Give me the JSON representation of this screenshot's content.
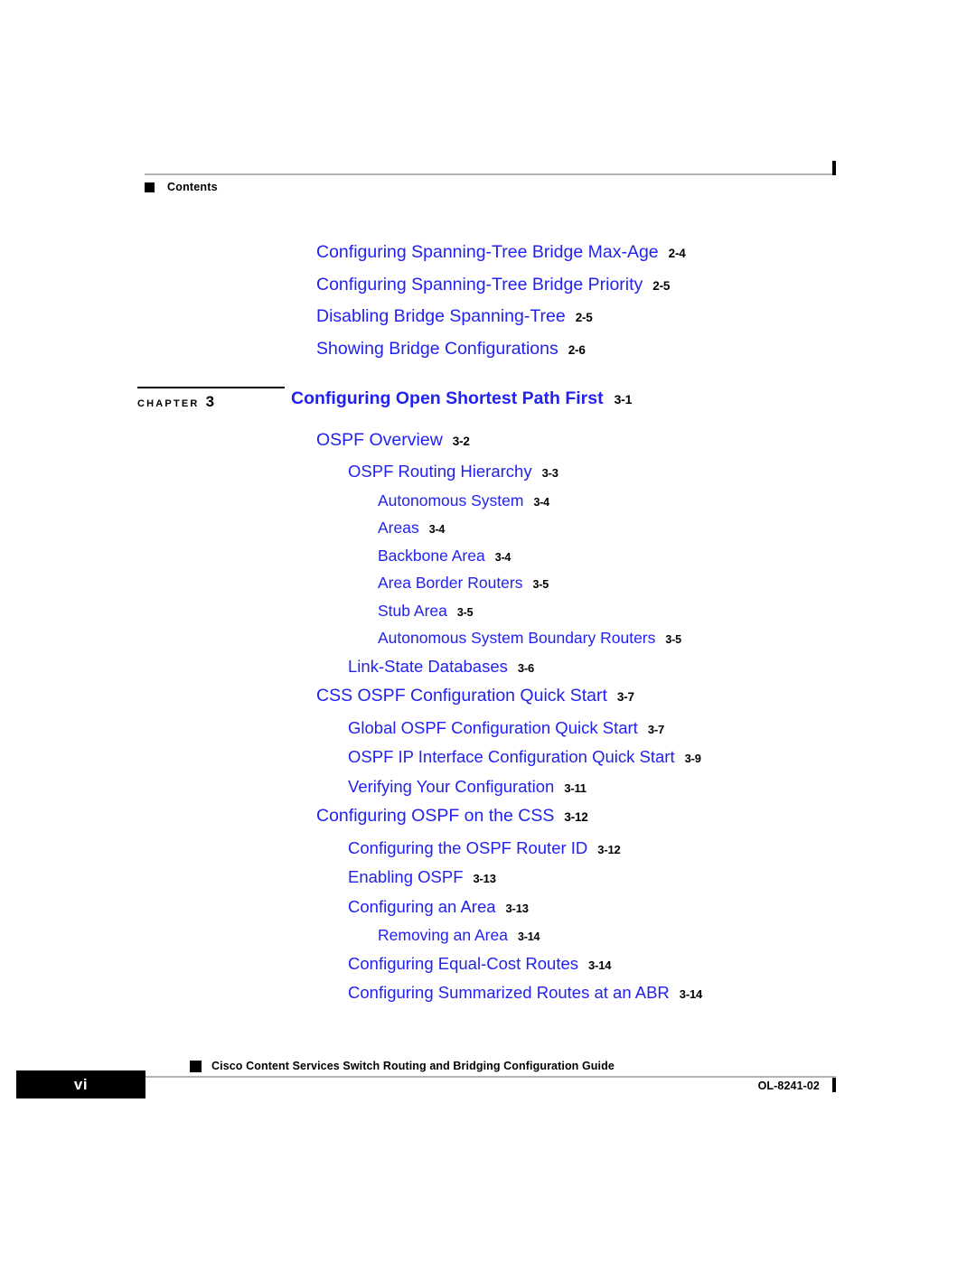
{
  "header": {
    "bullet_icon": "black-square-bullet",
    "title": "Contents",
    "tick_icon": "page-edge-tick"
  },
  "toc": {
    "entries": [
      {
        "title": "Configuring Spanning-Tree Bridge Max-Age",
        "page": "2-4",
        "level": 1
      },
      {
        "title": "Configuring Spanning-Tree Bridge Priority",
        "page": "2-5",
        "level": 1
      },
      {
        "title": "Disabling Bridge Spanning-Tree",
        "page": "2-5",
        "level": 1
      },
      {
        "title": "Showing Bridge Configurations",
        "page": "2-6",
        "level": 1
      }
    ]
  },
  "chapter": {
    "label_word": "CHAPTER",
    "number": "3",
    "title": "Configuring Open Shortest Path First",
    "page": "3-1"
  },
  "chapter_toc": {
    "entries": [
      {
        "title": "OSPF Overview",
        "page": "3-2",
        "level": 1
      },
      {
        "title": "OSPF Routing Hierarchy",
        "page": "3-3",
        "level": 2
      },
      {
        "title": "Autonomous System",
        "page": "3-4",
        "level": 3
      },
      {
        "title": "Areas",
        "page": "3-4",
        "level": 3
      },
      {
        "title": "Backbone Area",
        "page": "3-4",
        "level": 3
      },
      {
        "title": "Area Border Routers",
        "page": "3-5",
        "level": 3
      },
      {
        "title": "Stub Area",
        "page": "3-5",
        "level": 3
      },
      {
        "title": "Autonomous System Boundary Routers",
        "page": "3-5",
        "level": 3
      },
      {
        "title": "Link-State Databases",
        "page": "3-6",
        "level": 2
      },
      {
        "title": "CSS OSPF Configuration Quick Start",
        "page": "3-7",
        "level": 1
      },
      {
        "title": "Global OSPF Configuration Quick Start",
        "page": "3-7",
        "level": 2
      },
      {
        "title": "OSPF IP Interface Configuration Quick Start",
        "page": "3-9",
        "level": 2
      },
      {
        "title": "Verifying Your Configuration",
        "page": "3-11",
        "level": 2
      },
      {
        "title": "Configuring OSPF on the CSS",
        "page": "3-12",
        "level": 1
      },
      {
        "title": "Configuring the OSPF Router ID",
        "page": "3-12",
        "level": 2
      },
      {
        "title": "Enabling OSPF",
        "page": "3-13",
        "level": 2
      },
      {
        "title": "Configuring an Area",
        "page": "3-13",
        "level": 2
      },
      {
        "title": "Removing an Area",
        "page": "3-14",
        "level": 3
      },
      {
        "title": "Configuring Equal-Cost Routes",
        "page": "3-14",
        "level": 2
      },
      {
        "title": "Configuring Summarized Routes at an ABR",
        "page": "3-14",
        "level": 2
      }
    ]
  },
  "footer": {
    "bullet_icon": "black-square-bullet",
    "guide_title": "Cisco Content Services Switch Routing and Bridging Configuration Guide",
    "page_number": "vi",
    "doc_id": "OL-8241-02",
    "tick_icon": "page-edge-tick"
  },
  "colors": {
    "link_blue": "#2222EE",
    "rule_gray": "#B4B4B4",
    "ink_black": "#000000"
  }
}
